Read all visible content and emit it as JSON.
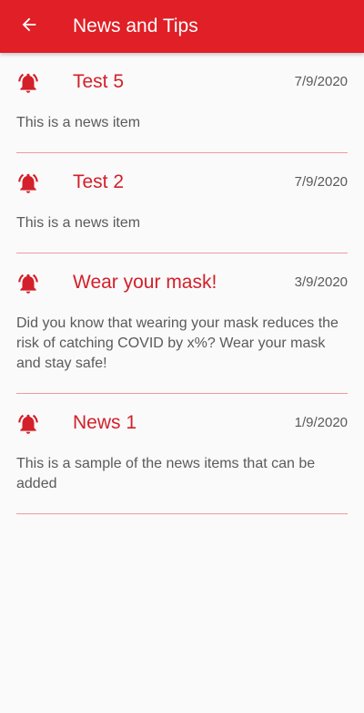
{
  "appbar": {
    "title": "News and Tips",
    "back_icon": "arrow-left-icon",
    "color": "#e01f26"
  },
  "news": {
    "icon": "bell-ring-icon",
    "accent": "#d3202a",
    "items": [
      {
        "title": "Test 5",
        "date": "7/9/2020",
        "body": "This is a news item"
      },
      {
        "title": "Test 2",
        "date": "7/9/2020",
        "body": "This is a news item"
      },
      {
        "title": "Wear your mask!",
        "date": "3/9/2020",
        "body": "Did you know that wearing your mask reduces the risk of catching COVID by x%? Wear your mask and stay safe!"
      },
      {
        "title": "News 1",
        "date": "1/9/2020",
        "body": "This is a sample of the news items that can be added"
      }
    ]
  }
}
